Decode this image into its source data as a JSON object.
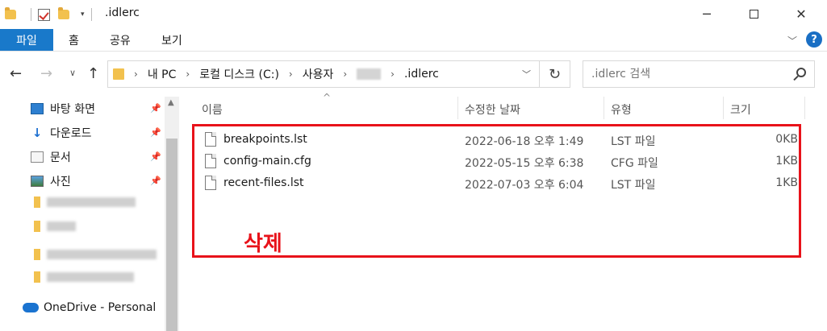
{
  "window": {
    "title": ".idlerc"
  },
  "ribbon": {
    "file": "파일",
    "home": "홈",
    "share": "공유",
    "view": "보기",
    "help": "?"
  },
  "nav": {
    "breadcrumb": [
      "내 PC",
      "로컬 디스크 (C:)",
      "사용자",
      ".idlerc"
    ],
    "search_placeholder": ".idlerc 검색"
  },
  "sidebar": {
    "quick_access": [
      {
        "label": "바탕 화면",
        "icon": "desktop-icon"
      },
      {
        "label": "다운로드",
        "icon": "download-icon"
      },
      {
        "label": "문서",
        "icon": "document-icon"
      },
      {
        "label": "사진",
        "icon": "pictures-icon"
      }
    ],
    "onedrive": "OneDrive - Personal"
  },
  "columns": {
    "name": "이름",
    "date": "수정한 날짜",
    "type": "유형",
    "size": "크기"
  },
  "files": [
    {
      "name": "breakpoints.lst",
      "date": "2022-06-18 오후 1:49",
      "type": "LST 파일",
      "size": "0KB"
    },
    {
      "name": "config-main.cfg",
      "date": "2022-05-15 오후 6:38",
      "type": "CFG 파일",
      "size": "1KB"
    },
    {
      "name": "recent-files.lst",
      "date": "2022-07-03 오후 6:04",
      "type": "LST 파일",
      "size": "1KB"
    }
  ],
  "annotation": {
    "label": "삭제",
    "color": "#e8121a"
  },
  "colors": {
    "accent": "#1979ca"
  }
}
